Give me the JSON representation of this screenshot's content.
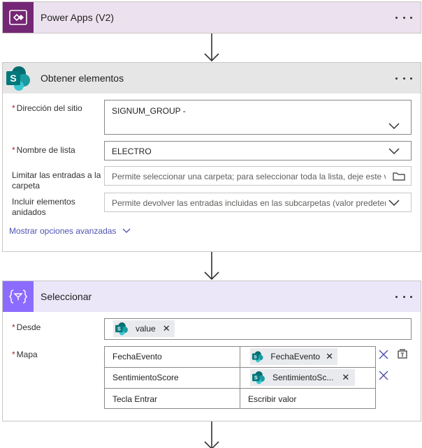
{
  "powerapps": {
    "title": "Power Apps (V2)",
    "icon": "power-apps-icon"
  },
  "get_items": {
    "title": "Obtener elementos",
    "icon": "sharepoint-icon",
    "site_label": "Dirección del sitio",
    "site_value": "SIGNUM_GROUP -",
    "list_label": "Nombre de lista",
    "list_value": "ELECTRO",
    "folder_label_1": "Limitar las entradas a la",
    "folder_label_2": "carpeta",
    "folder_placeholder": "Permite seleccionar una carpeta; para seleccionar toda la lista, deje este v",
    "nested_label_1": "Incluir elementos",
    "nested_label_2": "anidados",
    "nested_placeholder": "Permite devolver las entradas incluidas en las subcarpetas (valor predeter",
    "advanced_label": "Mostrar opciones avanzadas"
  },
  "select": {
    "title": "Seleccionar",
    "icon": "data-operation-icon",
    "from_label": "Desde",
    "from_token": "value",
    "map_label": "Mapa",
    "rows": [
      {
        "key": "FechaEvento",
        "value_token": "FechaEvento"
      },
      {
        "key": "SentimientoScore",
        "value_token": "SentimientoSc..."
      }
    ],
    "key_placeholder": "Tecla Entrar",
    "value_placeholder": "Escribir valor"
  },
  "colors": {
    "powerapps_header": "#ece2ef",
    "powerapps_icon": "#742774",
    "sharepoint_header": "#e6e6e6",
    "select_header": "#ebe6f8",
    "select_icon": "#8c6cff",
    "link": "#4f52b2",
    "required": "#a4262c"
  }
}
